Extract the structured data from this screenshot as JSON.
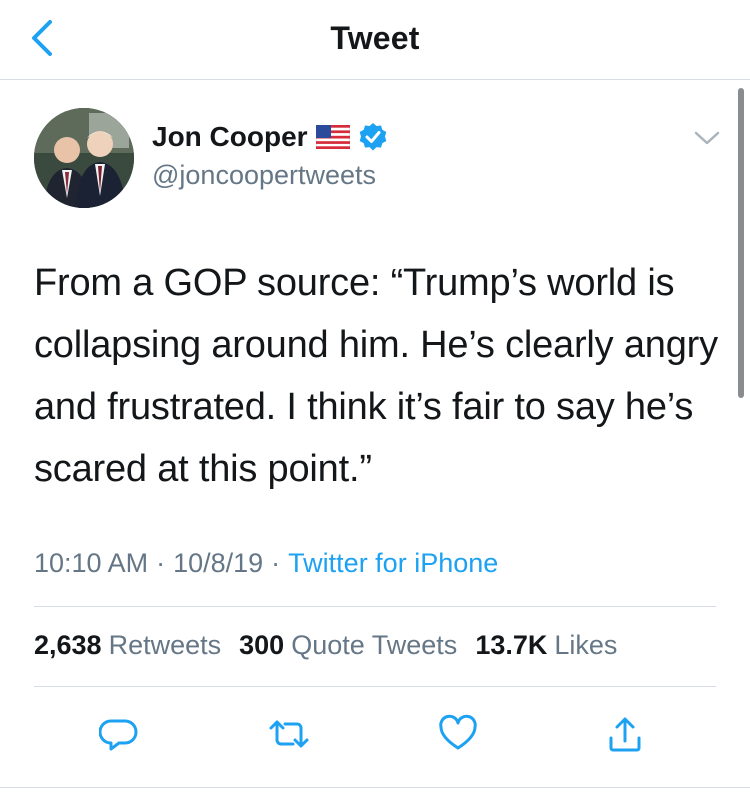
{
  "nav": {
    "title": "Tweet",
    "back_icon": "chevron-left-icon"
  },
  "colors": {
    "accent": "#1da1f2",
    "secondary_text": "#657786",
    "primary_text": "#14171a",
    "divider": "#d7dde2"
  },
  "tweet": {
    "author_name": "Jon Cooper",
    "author_handle": "@joncoopertweets",
    "badges": [
      "us-flag-icon",
      "verified-badge-icon"
    ],
    "text": "From a GOP source: “Trump’s world is collapsing around him. He’s clearly angry and frustrated. I think it’s fair to say he’s scared at this point.”",
    "time": "10:10 AM",
    "date": "10/8/19",
    "separator": "·",
    "source": "Twitter for iPhone"
  },
  "stats": {
    "retweets_count": "2,638",
    "retweets_label": "Retweets",
    "quotes_count": "300",
    "quotes_label": "Quote Tweets",
    "likes_count": "13.7K",
    "likes_label": "Likes"
  },
  "actions": [
    "reply-icon",
    "retweet-icon",
    "like-icon",
    "share-icon"
  ]
}
